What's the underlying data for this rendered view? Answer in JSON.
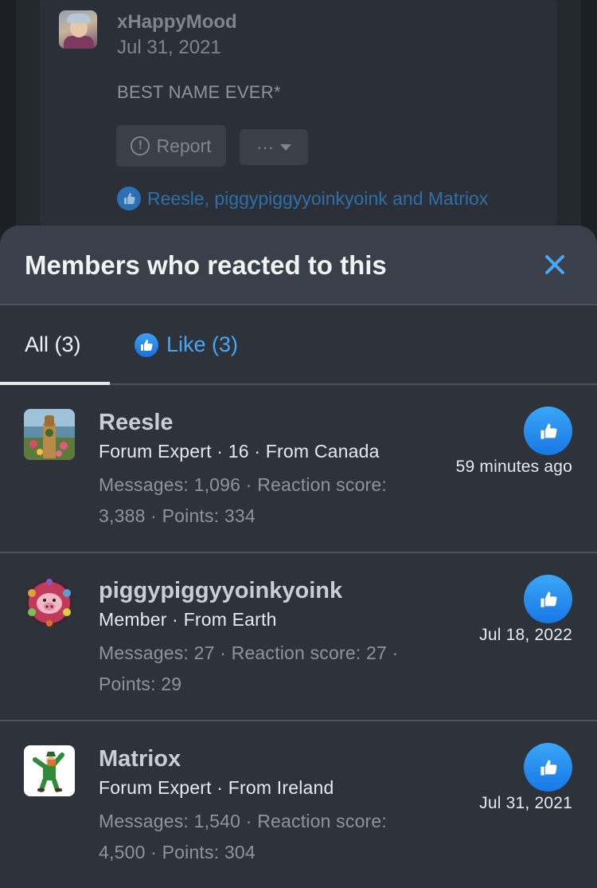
{
  "post": {
    "username": "xHappyMood",
    "date": "Jul 31, 2021",
    "body": "BEST NAME EVER*",
    "report_label": "Report",
    "more_label": "···",
    "reactions_summary": "Reesle, piggypiggyyoinkyoink and Matriox"
  },
  "sheet": {
    "title": "Members who reacted to this",
    "close_icon": "close-icon",
    "tabs": [
      {
        "label": "All (3)",
        "active": true
      },
      {
        "label": "Like (3)",
        "active": false
      }
    ]
  },
  "members": [
    {
      "name": "Reesle",
      "meta": "Forum Expert · 16 · From Canada",
      "stats": "Messages: 1,096 · Reaction score: 3,388 · Points: 334",
      "time": "59 minutes ago",
      "reaction_icon": "like-icon"
    },
    {
      "name": "piggypiggyyoinkyoink",
      "meta": "Member · From Earth",
      "stats": "Messages: 27 · Reaction score: 27 · Points: 29",
      "time": "Jul 18, 2022",
      "reaction_icon": "like-icon"
    },
    {
      "name": "Matriox",
      "meta": "Forum Expert · From Ireland",
      "stats": "Messages: 1,540 · Reaction score: 4,500 · Points: 304",
      "time": "Jul 31, 2021",
      "reaction_icon": "like-icon"
    }
  ],
  "colors": {
    "accent": "#47a7f5",
    "like_blue": "#1877e6",
    "sheet_bg": "#2e323b",
    "header_bg": "#394049"
  }
}
